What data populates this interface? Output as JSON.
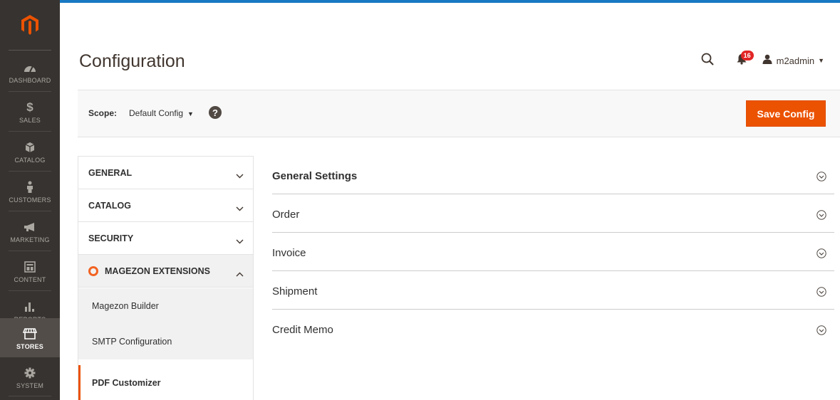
{
  "nav": {
    "items": [
      {
        "label": "DASHBOARD",
        "icon": "dashboard-icon"
      },
      {
        "label": "SALES",
        "icon": "dollar-icon"
      },
      {
        "label": "CATALOG",
        "icon": "cube-icon"
      },
      {
        "label": "CUSTOMERS",
        "icon": "person-icon"
      },
      {
        "label": "MARKETING",
        "icon": "megaphone-icon"
      },
      {
        "label": "CONTENT",
        "icon": "layout-icon"
      },
      {
        "label": "REPORTS",
        "icon": "bar-chart-icon"
      },
      {
        "label": "STORES",
        "icon": "store-icon",
        "active": true
      },
      {
        "label": "SYSTEM",
        "icon": "gear-icon"
      }
    ]
  },
  "header": {
    "title": "Configuration",
    "notification_count": "16",
    "user_name": "m2admin"
  },
  "scope": {
    "label": "Scope:",
    "value": "Default Config",
    "save_label": "Save Config"
  },
  "tabs": {
    "groups": [
      {
        "label": "GENERAL",
        "expanded": false
      },
      {
        "label": "CATALOG",
        "expanded": false
      },
      {
        "label": "SECURITY",
        "expanded": false
      },
      {
        "label": "MAGEZON EXTENSIONS",
        "expanded": true
      }
    ],
    "sub_items": [
      {
        "label": "Magezon Builder"
      },
      {
        "label": "SMTP Configuration"
      },
      {
        "label": "PDF Customizer",
        "active": true
      }
    ]
  },
  "sections": [
    {
      "title": "General Settings"
    },
    {
      "title": "Order"
    },
    {
      "title": "Invoice"
    },
    {
      "title": "Shipment"
    },
    {
      "title": "Credit Memo"
    }
  ],
  "colors": {
    "nav_bg": "#373330",
    "accent": "#eb5202",
    "badge": "#e22626",
    "magezon": "#f26322"
  }
}
